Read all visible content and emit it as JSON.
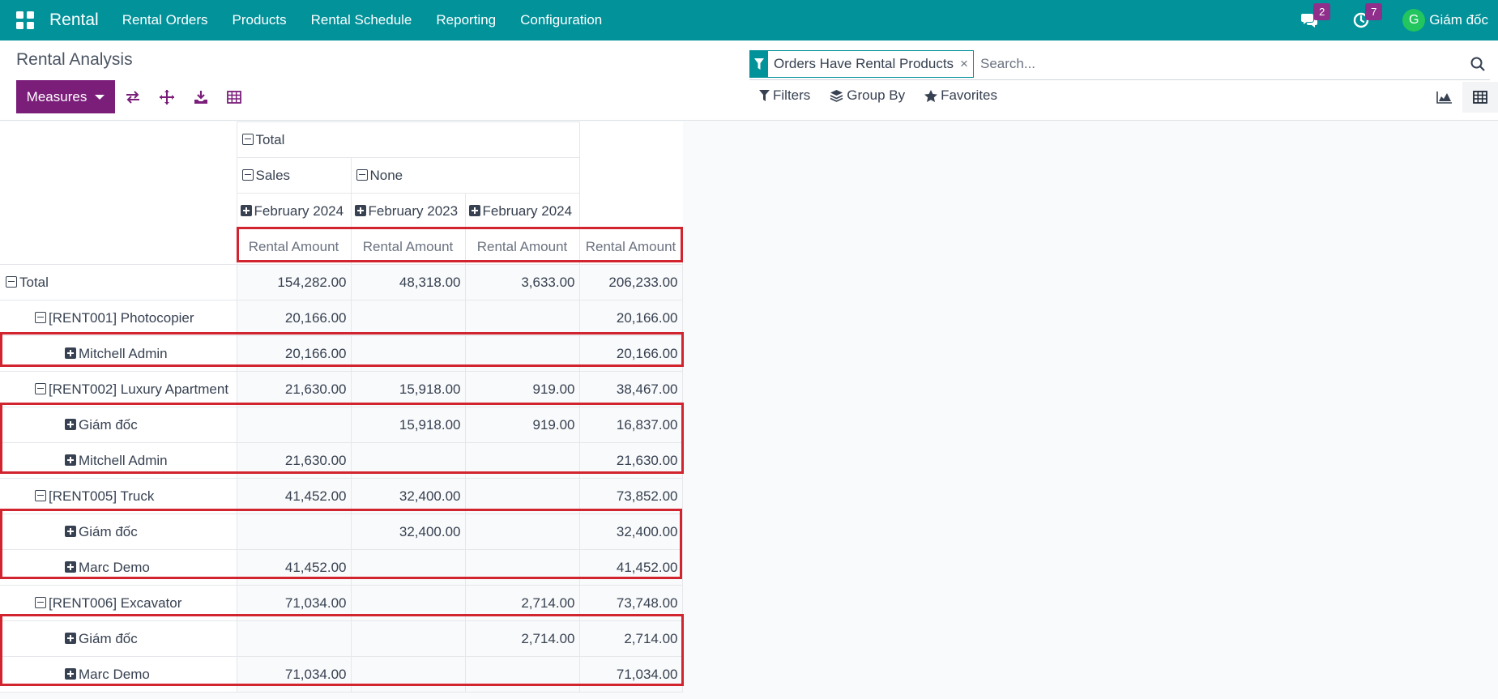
{
  "navbar": {
    "brand": "Rental",
    "menu": [
      "Rental Orders",
      "Products",
      "Rental Schedule",
      "Reporting",
      "Configuration"
    ],
    "messages_count": "2",
    "activities_count": "7",
    "avatar_initial": "G",
    "user_name": "Giám đốc"
  },
  "control_panel": {
    "title": "Rental Analysis",
    "measures_label": "Measures",
    "search": {
      "facet_label": "Orders Have Rental Products",
      "facet_close": "×",
      "placeholder": "Search..."
    },
    "filters_label": "Filters",
    "group_by_label": "Group By",
    "favorites_label": "Favorites"
  },
  "pivot": {
    "col_total": "Total",
    "col_groups": [
      "Sales",
      "None"
    ],
    "col_dates": [
      "February 2024",
      "February 2023",
      "February 2024"
    ],
    "measures": [
      "Rental Amount",
      "Rental Amount",
      "Rental Amount",
      "Rental Amount"
    ],
    "rows": [
      {
        "label": "Total",
        "values": [
          "154,282.00",
          "48,318.00",
          "3,633.00",
          "206,233.00"
        ]
      },
      {
        "label": "[RENT001] Photocopier",
        "values": [
          "20,166.00",
          "",
          "",
          "20,166.00"
        ]
      },
      {
        "label": "Mitchell Admin",
        "values": [
          "20,166.00",
          "",
          "",
          "20,166.00"
        ]
      },
      {
        "label": "[RENT002] Luxury Apartment",
        "values": [
          "21,630.00",
          "15,918.00",
          "919.00",
          "38,467.00"
        ]
      },
      {
        "label": "Giám đốc",
        "values": [
          "",
          "15,918.00",
          "919.00",
          "16,837.00"
        ]
      },
      {
        "label": "Mitchell Admin",
        "values": [
          "21,630.00",
          "",
          "",
          "21,630.00"
        ]
      },
      {
        "label": "[RENT005] Truck",
        "values": [
          "41,452.00",
          "32,400.00",
          "",
          "73,852.00"
        ]
      },
      {
        "label": "Giám đốc",
        "values": [
          "",
          "32,400.00",
          "",
          "32,400.00"
        ]
      },
      {
        "label": "Marc Demo",
        "values": [
          "41,452.00",
          "",
          "",
          "41,452.00"
        ]
      },
      {
        "label": "[RENT006] Excavator",
        "values": [
          "71,034.00",
          "",
          "2,714.00",
          "73,748.00"
        ]
      },
      {
        "label": "Giám đốc",
        "values": [
          "",
          "",
          "2,714.00",
          "2,714.00"
        ]
      },
      {
        "label": "Marc Demo",
        "values": [
          "71,034.00",
          "",
          "",
          "71,034.00"
        ]
      }
    ]
  },
  "colors": {
    "navbar": "#01929a",
    "primary_button": "#7b1e7a",
    "badge": "#8f2f8b",
    "highlight": "#d1242f",
    "avatar": "#22c55e"
  }
}
